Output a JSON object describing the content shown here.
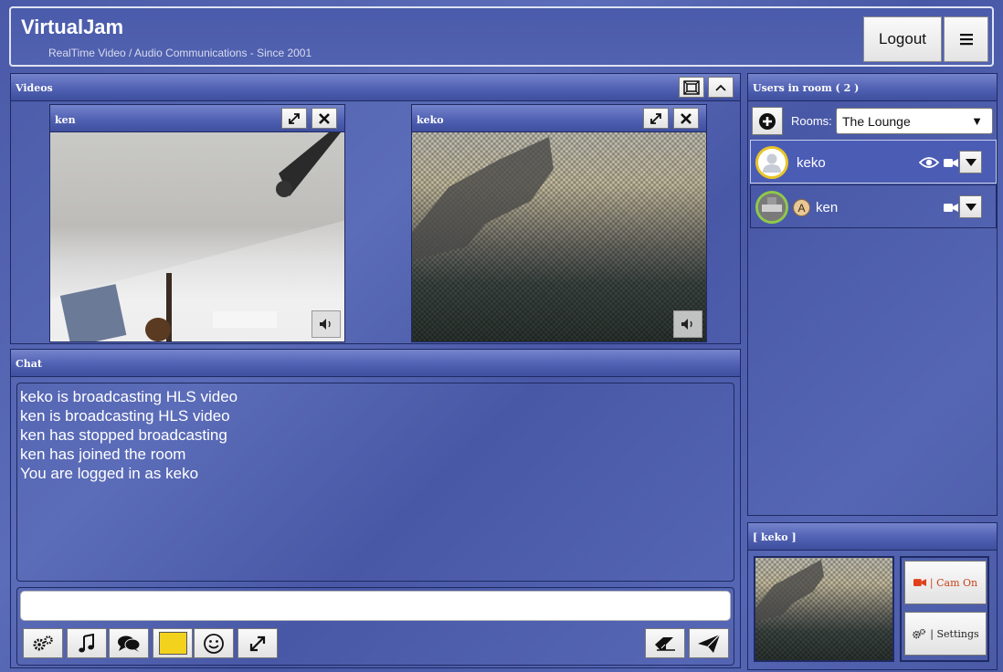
{
  "app": {
    "title": "VirtualJam",
    "subtitle": "RealTime Video / Audio Communications - Since 2001",
    "logout_label": "Logout",
    "menu_icon": "hamburger-icon"
  },
  "videos": {
    "title": "Videos",
    "tiles": [
      {
        "name": "ken"
      },
      {
        "name": "keko"
      }
    ]
  },
  "chat": {
    "title": "Chat",
    "messages": [
      "keko is broadcasting HLS video",
      "ken is broadcasting HLS video",
      "ken has stopped broadcasting",
      "ken has joined the room",
      "You are logged in as keko"
    ],
    "input_value": "",
    "color_swatch": "#f3d21e"
  },
  "users": {
    "title": "Users in room ( 2 )",
    "rooms_label": "Rooms:",
    "selected_room": "The Lounge",
    "list": [
      {
        "name": "keko",
        "badge": "",
        "watching": true,
        "camera": true
      },
      {
        "name": "ken",
        "badge": "A",
        "watching": false,
        "camera": true
      }
    ]
  },
  "self": {
    "title": "[ keko ]",
    "cam_label": "| Cam On",
    "settings_label": "| Settings"
  }
}
